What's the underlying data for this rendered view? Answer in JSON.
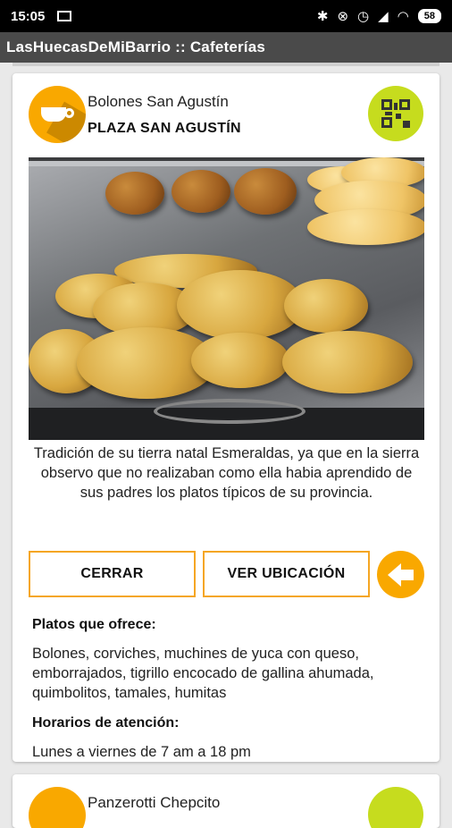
{
  "status_bar": {
    "time": "15:05",
    "battery": "58",
    "icons": [
      "mail-icon",
      "bluetooth-icon",
      "mute-icon",
      "alarm-icon",
      "signal-icon",
      "wifi-icon",
      "battery-icon"
    ]
  },
  "app_bar": {
    "title": "LasHuecasDeMiBarrio :: Cafeterías"
  },
  "card": {
    "brand": "Bolones San Agustín",
    "place": "PLAZA SAN AGUSTÍN",
    "badge_icon": "coffee-cup-icon",
    "qr_icon": "qr-code-icon",
    "photo_icon": "food-photo",
    "description": "Tradición de su tierra natal Esmeraldas, ya que en la sierra observo que no realizaban como ella habia aprendido de sus padres los platos típicos de su provincia.",
    "buttons": {
      "close": "CERRAR",
      "location": "VER UBICACIÓN"
    },
    "dishes_title": "Platos que ofrece:",
    "dishes_text": "Bolones, corviches, muchines de yuca con queso, emborrajados, tigrillo encocado de gallina ahumada, quimbolitos,  tamales, humitas",
    "hours_title": "Horarios de atención:",
    "hours_text": "Lunes a viernes de 7 am a 18 pm"
  },
  "next_card": {
    "brand": "Panzerotti Chepcito"
  },
  "colors": {
    "accent_orange": "#f9a800",
    "qr_green": "#c6dc1e",
    "appbar": "#4a4a4a"
  }
}
